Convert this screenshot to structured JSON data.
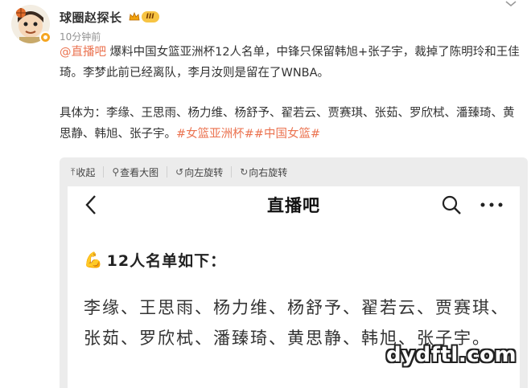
{
  "post": {
    "username": "球圈赵探长",
    "vip_level": "III",
    "timestamp": "10分钟前",
    "mention": "@直播吧",
    "paragraph1": " 爆料中国女篮亚洲杯12人名单，中锋只保留韩旭+张子宇，裁掉了陈明玲和王佳琦。李梦此前已经离队，李月汝则是留在了WNBA。",
    "paragraph2": "具体为：李缘、王思雨、杨力维、杨舒予、翟若云、贾赛琪、张茹、罗欣栻、潘臻琦、黄思静、韩旭、张子宇。",
    "hashtags": "#女篮亚洲杯##中国女篮#"
  },
  "media_toolbar": {
    "collapse": "收起",
    "view_large": "查看大图",
    "rotate_left": "向左旋转",
    "rotate_right": "向右旋转",
    "icons": {
      "collapse": "collapse-up-icon",
      "view_large": "magnifier-icon",
      "rotate_left": "rotate-left-icon",
      "rotate_right": "rotate-right-icon"
    }
  },
  "embedded_app": {
    "title": "直播吧",
    "heading_emoji": "💪",
    "heading": "12人名单如下：",
    "roster_text": "李缘、王思雨、杨力维、杨舒予、翟若云、贾赛琪、张茹、罗欣栻、潘臻琦、黄思静、韩旭、张子宇。"
  },
  "watermark": "dydftl.com",
  "colors": {
    "link_orange": "#eb7350",
    "text": "#333333",
    "muted": "#939393",
    "media_bg": "#ececec"
  }
}
